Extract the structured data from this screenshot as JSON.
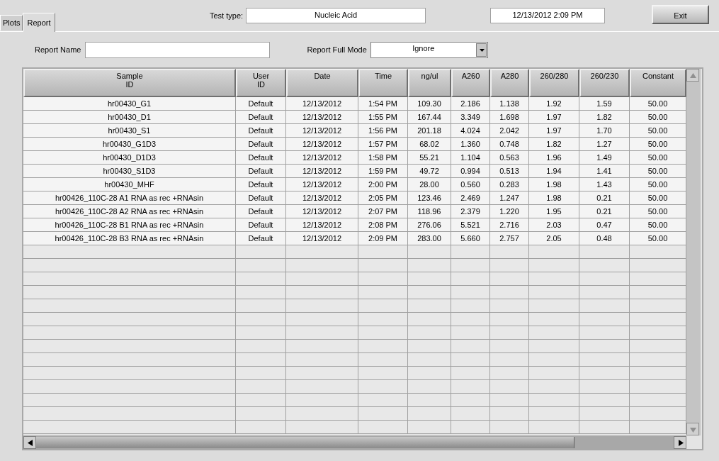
{
  "tabs": [
    {
      "label": "Plots",
      "selected": false
    },
    {
      "label": "Report",
      "selected": true
    }
  ],
  "test_type": {
    "label": "Test type:",
    "value": "Nucleic Acid"
  },
  "datetime": "12/13/2012  2:09 PM",
  "exit_button": "Exit",
  "report_name": {
    "label": "Report Name"
  },
  "report_full_mode": {
    "label": "Report Full Mode",
    "value": "Ignore"
  },
  "table": {
    "columns": [
      "Sample ID",
      "User ID",
      "Date",
      "Time",
      "ng/ul",
      "A260",
      "A280",
      "260/280",
      "260/230",
      "Constant"
    ],
    "rows": [
      [
        "hr00430_G1",
        "Default",
        "12/13/2012",
        "1:54 PM",
        "109.30",
        "2.186",
        "1.138",
        "1.92",
        "1.59",
        "50.00"
      ],
      [
        "hr00430_D1",
        "Default",
        "12/13/2012",
        "1:55 PM",
        "167.44",
        "3.349",
        "1.698",
        "1.97",
        "1.82",
        "50.00"
      ],
      [
        "hr00430_S1",
        "Default",
        "12/13/2012",
        "1:56 PM",
        "201.18",
        "4.024",
        "2.042",
        "1.97",
        "1.70",
        "50.00"
      ],
      [
        "hr00430_G1D3",
        "Default",
        "12/13/2012",
        "1:57 PM",
        "68.02",
        "1.360",
        "0.748",
        "1.82",
        "1.27",
        "50.00"
      ],
      [
        "hr00430_D1D3",
        "Default",
        "12/13/2012",
        "1:58 PM",
        "55.21",
        "1.104",
        "0.563",
        "1.96",
        "1.49",
        "50.00"
      ],
      [
        "hr00430_S1D3",
        "Default",
        "12/13/2012",
        "1:59 PM",
        "49.72",
        "0.994",
        "0.513",
        "1.94",
        "1.41",
        "50.00"
      ],
      [
        "hr00430_MHF",
        "Default",
        "12/13/2012",
        "2:00 PM",
        "28.00",
        "0.560",
        "0.283",
        "1.98",
        "1.43",
        "50.00"
      ],
      [
        "hr00426_110C-28 A1 RNA as rec +RNAsin",
        "Default",
        "12/13/2012",
        "2:05 PM",
        "123.46",
        "2.469",
        "1.247",
        "1.98",
        "0.21",
        "50.00"
      ],
      [
        "hr00426_110C-28 A2 RNA as rec +RNAsin",
        "Default",
        "12/13/2012",
        "2:07 PM",
        "118.96",
        "2.379",
        "1.220",
        "1.95",
        "0.21",
        "50.00"
      ],
      [
        "hr00426_110C-28 B1 RNA as rec +RNAsin",
        "Default",
        "12/13/2012",
        "2:08 PM",
        "276.06",
        "5.521",
        "2.716",
        "2.03",
        "0.47",
        "50.00"
      ],
      [
        "hr00426_110C-28 B3 RNA as rec +RNAsin",
        "Default",
        "12/13/2012",
        "2:09 PM",
        "283.00",
        "5.660",
        "2.757",
        "2.05",
        "0.48",
        "50.00"
      ]
    ]
  }
}
